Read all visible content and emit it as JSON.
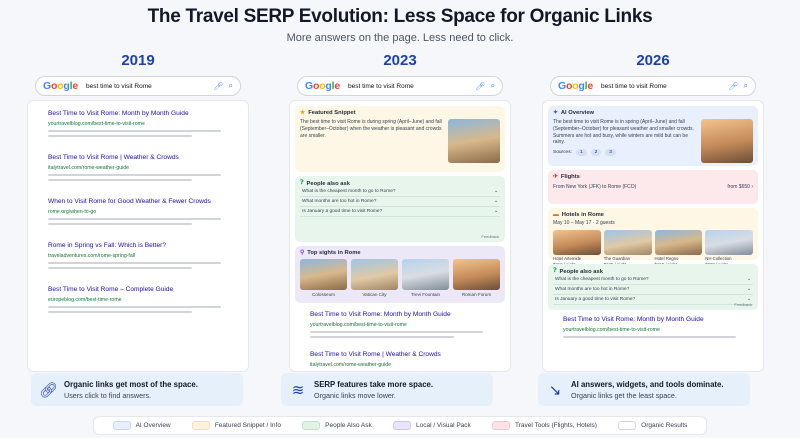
{
  "header": {
    "title": "The Travel SERP Evolution: Less Space for Organic Links",
    "subtitle": "More answers on the page. Less need to click."
  },
  "search": {
    "query": "best time to visit Rome",
    "logo": "Google"
  },
  "col2019": {
    "year": "2019",
    "results": [
      {
        "title": "Best Time to Visit Rome: Month by Month Guide",
        "url": "yourtravelblog.com/best-time-to-visit-rome"
      },
      {
        "title": "Best Time to Visit Rome | Weather & Crowds",
        "url": "italytravel.com/rome-weather-guide"
      },
      {
        "title": "When to Visit Rome for Good Weather & Fewer Crowds",
        "url": "rome.org/when-to-go"
      },
      {
        "title": "Rome in Spring vs Fall: Which is Better?",
        "url": "traveladventures.com/rome-spring-fall"
      },
      {
        "title": "Best Time to Visit Rome – Complete Guide",
        "url": "europeblog.com/best-time-rome"
      }
    ]
  },
  "col2023": {
    "year": "2023",
    "snippet": {
      "heading": "Featured Snippet",
      "text": "The best time to visit Rome is during spring (April–June) and fall (September–October) when the weather is pleasant and crowds are smaller."
    },
    "paa": {
      "heading": "People also ask",
      "questions": [
        "What is the cheapest month to go to Rome?",
        "What months are too hot in Rome?",
        "Is January a good time to visit Rome?"
      ],
      "feedback": "Feedback"
    },
    "sights": {
      "heading": "Top sights in Rome",
      "items": [
        "Colosseum",
        "Vatican City",
        "Trevi Fountain",
        "Roman Forum"
      ]
    },
    "results": [
      {
        "title": "Best Time to Visit Rome: Month by Month Guide",
        "url": "yourtravelblog.com/best-time-to-visit-rome"
      },
      {
        "title": "Best Time to Visit Rome | Weather & Crowds",
        "url": "italytravel.com/rome-weather-guide"
      }
    ]
  },
  "col2026": {
    "year": "2026",
    "ai": {
      "heading": "AI Overview",
      "text": "The best time to visit Rome is in spring (April–June) and fall (September–October) for pleasant weather and smaller crowds. Summers are hot and busy, while winters are mild but can be rainy.",
      "sources_label": "Sources:",
      "sources": [
        "1",
        "2",
        "3"
      ]
    },
    "flights": {
      "heading": "Flights",
      "route": "From New York (JFK) to Rome (FCO)",
      "price": "from $650"
    },
    "hotels": {
      "heading": "Hotels in Rome",
      "dates": "May 10 – May 17",
      "guests": "2 guests",
      "items": [
        {
          "name": "Hotel Artemide",
          "price": "$216 / night"
        },
        {
          "name": "The Guardian",
          "price": "$185 / night"
        },
        {
          "name": "Hotel Regno",
          "price": "$160 / night"
        },
        {
          "name": "NH Collection",
          "price": "$220 / night"
        }
      ]
    },
    "paa": {
      "heading": "People also ask",
      "questions": [
        "What is the cheapest month to go to Rome?",
        "What months are too hot in Rome?",
        "Is January a good time to visit Rome?"
      ],
      "feedback": "Feedback"
    },
    "result": {
      "title": "Best Time to Visit Rome: Month by Month Guide",
      "url": "yourtravelblog.com/best-time-to-visit-rome"
    }
  },
  "footers": [
    {
      "bold": "Organic links get most of the space.",
      "text": "Users click to find answers."
    },
    {
      "bold": "SERP features take more space.",
      "text": "Organic links move lower."
    },
    {
      "bold": "AI answers, widgets, and tools dominate.",
      "text": "Organic links get the least space."
    }
  ],
  "legend": [
    {
      "label": "AI Overview",
      "color": "#e8f0fe"
    },
    {
      "label": "Featured Snippet / Info",
      "color": "#fef3d8"
    },
    {
      "label": "People Also Ask",
      "color": "#e3f3e7"
    },
    {
      "label": "Local / Visual Pack",
      "color": "#e9e4f7"
    },
    {
      "label": "Travel Tools (Flights, Hotels)",
      "color": "#fde4e8"
    },
    {
      "label": "Organic Results",
      "color": "#ffffff"
    }
  ]
}
